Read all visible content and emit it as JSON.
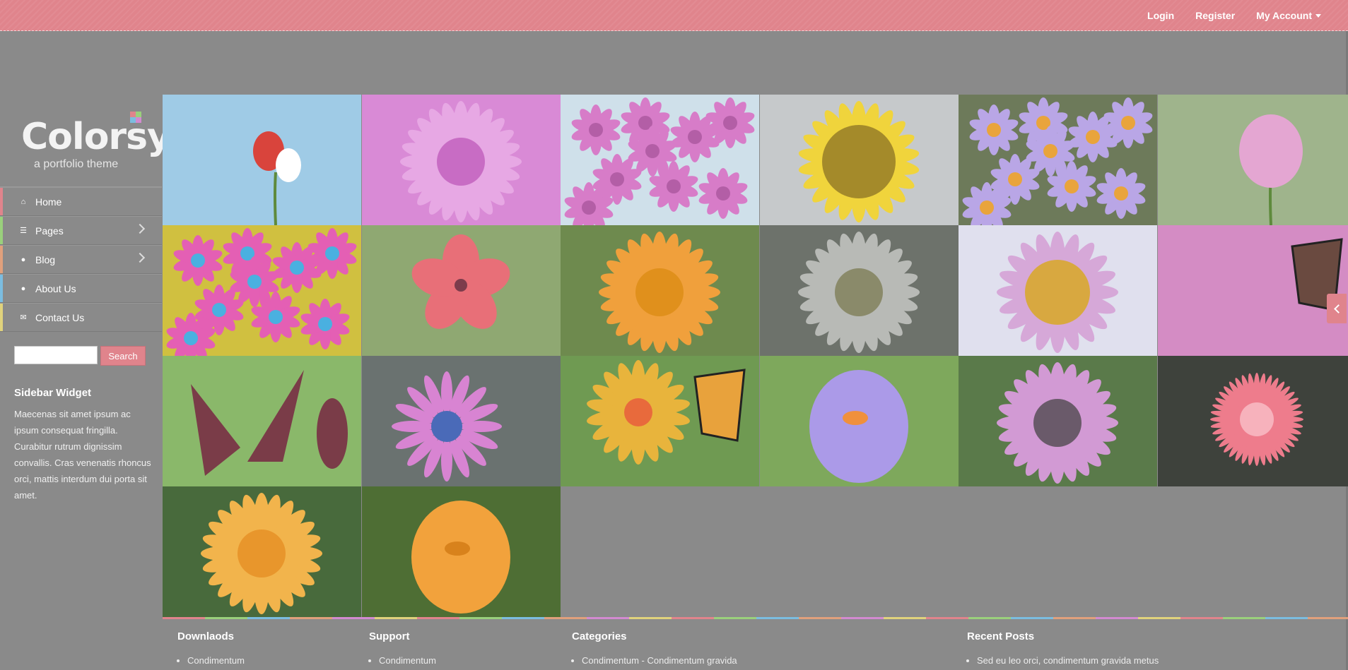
{
  "topnav": {
    "login": "Login",
    "register": "Register",
    "account": "My Account"
  },
  "brand": {
    "name": "Colorsy",
    "tagline": "a portfolio theme"
  },
  "menu": [
    {
      "label": "Home",
      "icon": "home-icon",
      "color": "#e0848c"
    },
    {
      "label": "Pages",
      "icon": "list-icon",
      "color": "#9ad07c"
    },
    {
      "label": "Blog",
      "icon": "comments-icon",
      "color": "#e0a07c"
    },
    {
      "label": "About Us",
      "icon": "user-icon",
      "color": "#7bbde0"
    },
    {
      "label": "Contact Us",
      "icon": "envelope-icon",
      "color": "#e0d27c"
    }
  ],
  "search": {
    "placeholder": "",
    "button": "Search"
  },
  "widget": {
    "title": "Sidebar Widget",
    "text": "Maecenas sit amet ipsum ac ipsum consequat fringilla. Curabitur rutrum dignissim convallis. Cras venenatis rhoncus orci, mattis interdum dui porta sit amet."
  },
  "gallery": [
    {
      "name": "red-white-tulips",
      "bg": "#9fcbe6",
      "petal": "#d9443c",
      "center": "#ffffff",
      "shape": "tulip"
    },
    {
      "name": "pink-dahlia",
      "bg": "#d98ad6",
      "petal": "#e7a8e4",
      "center": "#c86cc4",
      "shape": "dahlia"
    },
    {
      "name": "bougainvillea",
      "bg": "#cfe0ea",
      "petal": "#d77cc8",
      "center": "#b35ea6",
      "shape": "cluster"
    },
    {
      "name": "sunflower-bee",
      "bg": "#c6c9cb",
      "petal": "#f0d43c",
      "center": "#a48a2a",
      "shape": "sunflower"
    },
    {
      "name": "purple-asters",
      "bg": "#6d7a5a",
      "petal": "#b9a6e6",
      "center": "#e9a43c",
      "shape": "asters"
    },
    {
      "name": "pink-tulip",
      "bg": "#9fb48c",
      "petal": "#e4a6d2",
      "center": "#d48cc0",
      "shape": "tulip-single"
    },
    {
      "name": "colorful-chrysanthemums",
      "bg": "#d0c040",
      "petal": "#e45fb4",
      "center": "#4ab0e0",
      "shape": "mix"
    },
    {
      "name": "red-flax",
      "bg": "#8fa872",
      "petal": "#e86f78",
      "center": "#7c3c4c",
      "shape": "five"
    },
    {
      "name": "orange-gerbera",
      "bg": "#6e8a4e",
      "petal": "#f0a03c",
      "center": "#e0901c",
      "shape": "gerbera"
    },
    {
      "name": "white-daisy",
      "bg": "#6d726b",
      "petal": "#b8bab6",
      "center": "#8a8a6a",
      "shape": "daisy"
    },
    {
      "name": "echinacea",
      "bg": "#e0e0ee",
      "petal": "#d6a8d8",
      "center": "#d8a840",
      "shape": "cone"
    },
    {
      "name": "butterfly-pink",
      "bg": "#d48cc4",
      "petal": "#6a4a40",
      "center": "#d0604a",
      "shape": "butterfly"
    },
    {
      "name": "dark-lily",
      "bg": "#8ab86a",
      "petal": "#7a3c48",
      "center": "#a86070",
      "shape": "lily"
    },
    {
      "name": "osteospermum-spoon",
      "bg": "#6a7270",
      "petal": "#d884d2",
      "center": "#4a6ab8",
      "shape": "spoon"
    },
    {
      "name": "zinnia-monarch",
      "bg": "#6f9a52",
      "petal": "#e8b43c",
      "center": "#e86a3c",
      "shape": "monarch"
    },
    {
      "name": "purple-crocus",
      "bg": "#7ea85c",
      "petal": "#ab9ae8",
      "center": "#f0903c",
      "shape": "crocus"
    },
    {
      "name": "pink-osteospermum",
      "bg": "#5a7a4a",
      "petal": "#d29ad4",
      "center": "#6a5a6a",
      "shape": "daisy-pink"
    },
    {
      "name": "pink-bellis",
      "bg": "#3e423c",
      "petal": "#ee7c8c",
      "center": "#f7b2bc",
      "shape": "pompom"
    },
    {
      "name": "orange-dahlia",
      "bg": "#486a3c",
      "petal": "#f2b44c",
      "center": "#e8962c",
      "shape": "dahlia-orange"
    },
    {
      "name": "orange-crocus",
      "bg": "#4e6e34",
      "petal": "#f2a23c",
      "center": "#d8821c",
      "shape": "crocus-orange"
    }
  ],
  "footer": [
    {
      "title": "Downlaods",
      "item": "Condimentum"
    },
    {
      "title": "Support",
      "item": "Condimentum"
    },
    {
      "title": "Categories",
      "item": "Condimentum - Condimentum gravida"
    },
    {
      "title": "Recent Posts",
      "item": "Sed eu leo orci, condimentum gravida metus"
    }
  ]
}
